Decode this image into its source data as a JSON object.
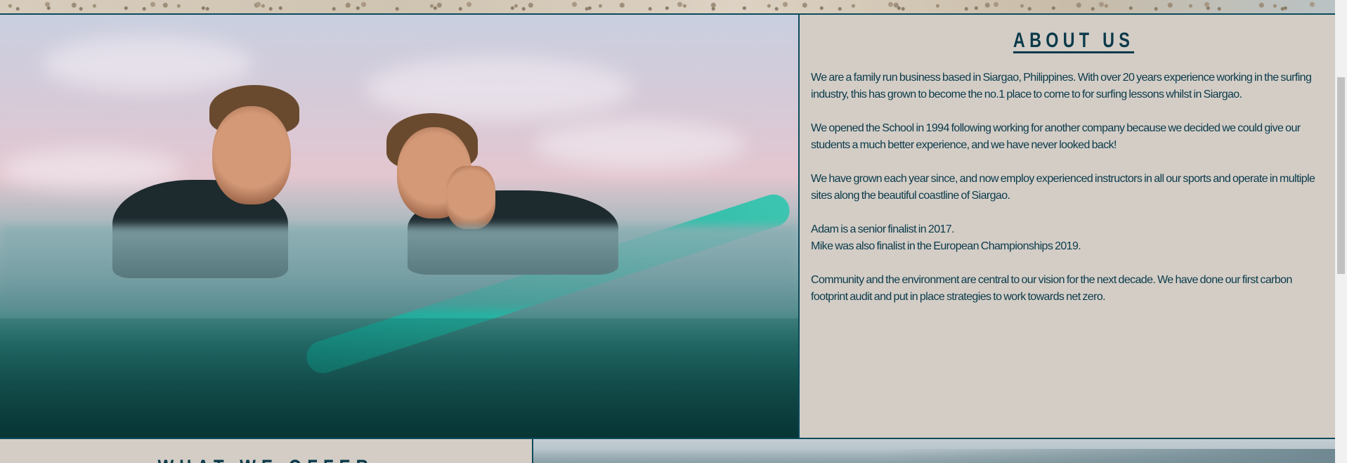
{
  "about": {
    "title": "ABOUT US",
    "paragraphs": [
      "We are a family run business based in Siargao, Philippines. With over 20 years experience working in the surfing industry, this has grown to become the no.1 place to come to for surfing lessons whilst in Siargao.",
      "We opened the School in 1994 following working for another company because we decided we could give our students a much better experience, and we have never looked back!",
      "We have grown each year since, and now employ experienced instructors in all our sports and operate in multiple sites along the beautiful coastline of Siargao.",
      "Adam is a senior finalist in 2017.\nMike was also finalist in the European Championships 2019.",
      "Community and the environment are central to our vision for the next decade. We have done our first carbon footprint audit and put in place strategies to work towards net zero."
    ]
  },
  "offer": {
    "title": "WHAT WE OFFER"
  },
  "colors": {
    "accent": "#0b3a4a",
    "panel": "#d3cdc6"
  }
}
